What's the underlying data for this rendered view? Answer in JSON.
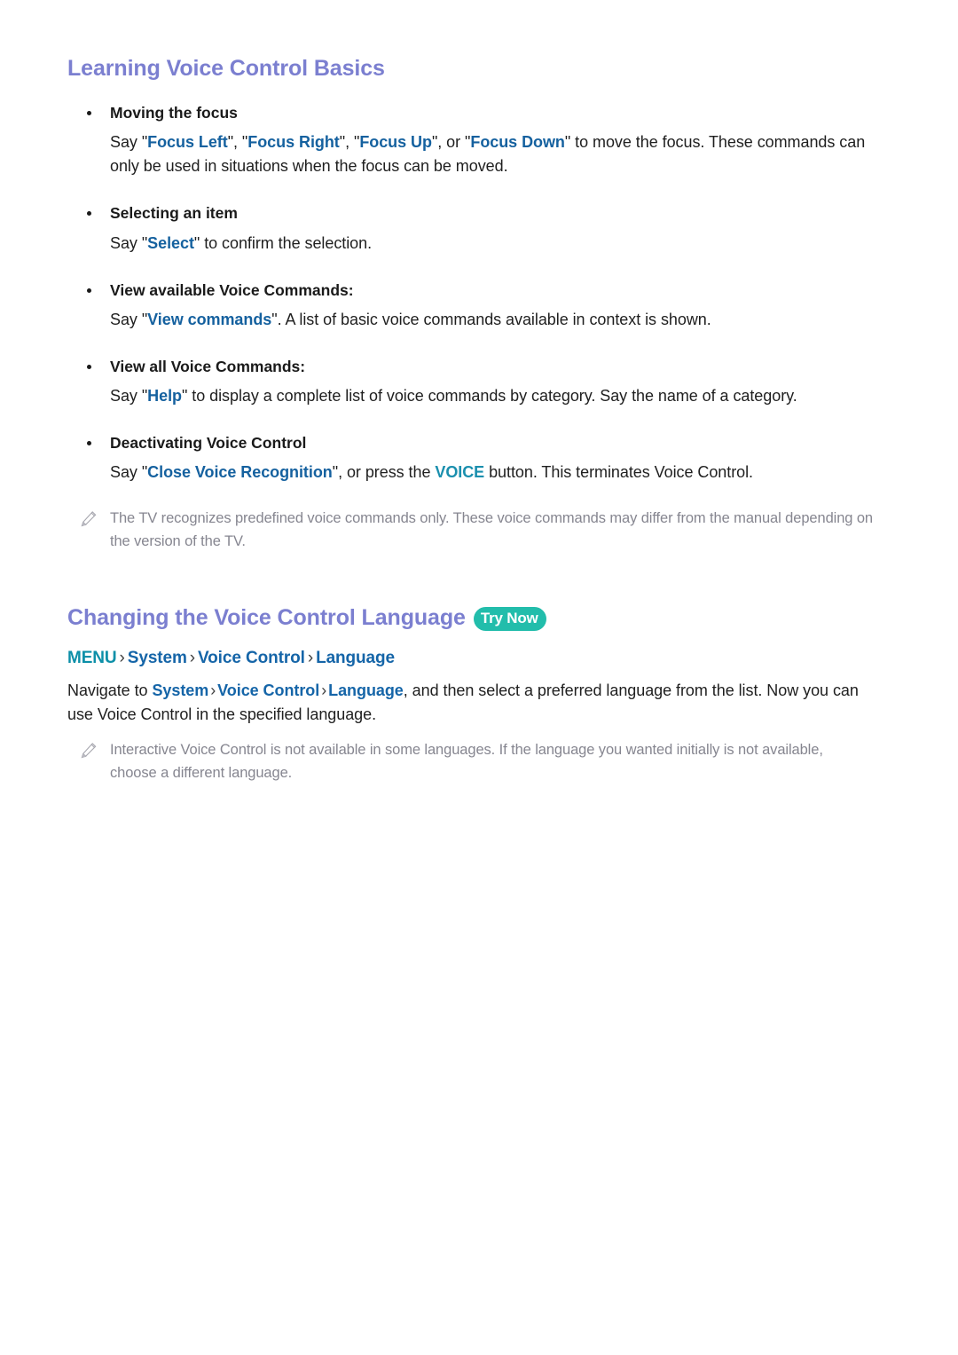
{
  "sections": [
    {
      "title": "Learning Voice Control Basics",
      "bullets": [
        {
          "head": "Moving the focus",
          "body_prefix": "Say \"",
          "cmd1": "Focus Left",
          "mid1": "\", \"",
          "cmd2": "Focus Right",
          "mid2": "\", \"",
          "cmd3": "Focus Up",
          "mid3": "\", or \"",
          "cmd4": "Focus Down",
          "body_suffix": "\" to move the focus. These commands can only be used in situations when the focus can be moved."
        },
        {
          "head": "Selecting an item",
          "body_prefix": "Say \"",
          "cmd1": "Select",
          "body_suffix": "\" to confirm the selection."
        },
        {
          "head": "View available Voice Commands:",
          "body_prefix": "Say \"",
          "cmd1": "View commands",
          "body_suffix": "\". A list of basic voice commands available in context is shown."
        },
        {
          "head": "View all Voice Commands:",
          "body_prefix": "Say \"",
          "cmd1": "Help",
          "body_suffix": "\" to display a complete list of voice commands by category. Say the name of a category."
        },
        {
          "head": "Deactivating Voice Control",
          "body_prefix": "Say \"",
          "cmd1": "Close Voice Recognition",
          "mid1": "\", or press the ",
          "key1": "VOICE",
          "body_suffix": " button. This terminates Voice Control."
        }
      ],
      "note": "The TV recognizes predefined voice commands only. These voice commands may differ from the manual depending on the version of the TV."
    },
    {
      "title": "Changing the Voice Control Language",
      "badge": "Try Now",
      "menu_path": {
        "root": "MENU",
        "item1": "System",
        "item2": "Voice Control",
        "item3": "Language",
        "separator": "›"
      },
      "paragraph": {
        "prefix": "Navigate to ",
        "link1": "System",
        "link2": "Voice Control",
        "link3": "Language",
        "separator": "›",
        "suffix": ", and then select a preferred language from the list. Now you can use Voice Control in the specified language."
      },
      "note": "Interactive Voice Control is not available in some languages. If the language you wanted initially is not available, choose a different language."
    }
  ]
}
